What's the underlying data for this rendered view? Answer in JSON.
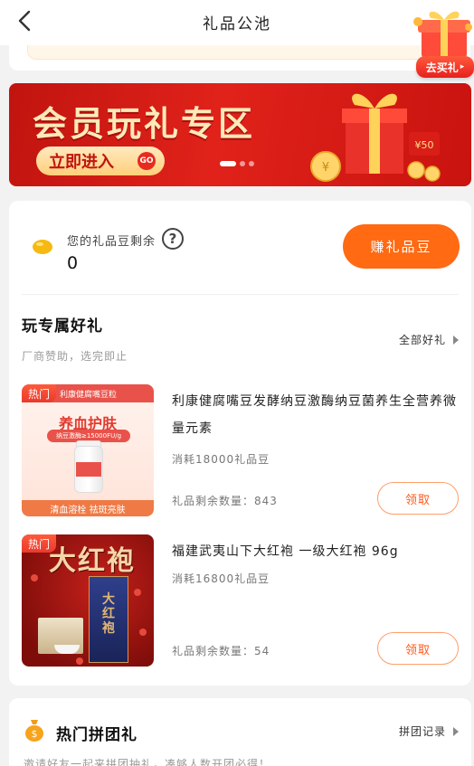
{
  "header": {
    "title": "礼品公池",
    "back_icon": "chevron-left-icon"
  },
  "float_gift": {
    "label": "去买礼"
  },
  "banner": {
    "title": "会员玩礼专区",
    "cta_label": "立即进入",
    "cta_badge": "GO",
    "price_tag": "¥50"
  },
  "beans": {
    "label": "您的礼品豆剩余",
    "help_icon": "?",
    "count": "0",
    "earn_button": "赚礼品豆"
  },
  "gifts_section": {
    "title": "玩专属好礼",
    "subtitle": "厂商赞助，选完即止",
    "all_link": "全部好礼"
  },
  "products": [
    {
      "tag": "热门",
      "image_strip": "利康健腐嘴豆粒",
      "image_title": "养血护肤",
      "image_pill": "纳豆激酶≥15000FU/g",
      "image_bottom": "清血溶栓 祛斑亮肤",
      "name": "利康健腐嘴豆发酵纳豆激酶纳豆菌养生全营养微量元素",
      "cost": "消耗18000礼品豆",
      "stock": "礼品剩余数量：843",
      "button": "领取"
    },
    {
      "tag": "热门",
      "image_title": "大红袍",
      "image_box_text": "大红袍",
      "name": "福建武夷山下大红袍 一级大红袍 96g",
      "cost": "消耗16800礼品豆",
      "stock": "礼品剩余数量：54",
      "button": "领取"
    }
  ],
  "group_section": {
    "title": "热门拼团礼",
    "record_link": "拼团记录",
    "subtitle": "邀请好友一起来拼团抽礼，凑够人数开团必得！"
  },
  "colors": {
    "accent": "#ff6a13",
    "banner_red": "#e0221a",
    "hot_tag": "#e93a2c"
  }
}
